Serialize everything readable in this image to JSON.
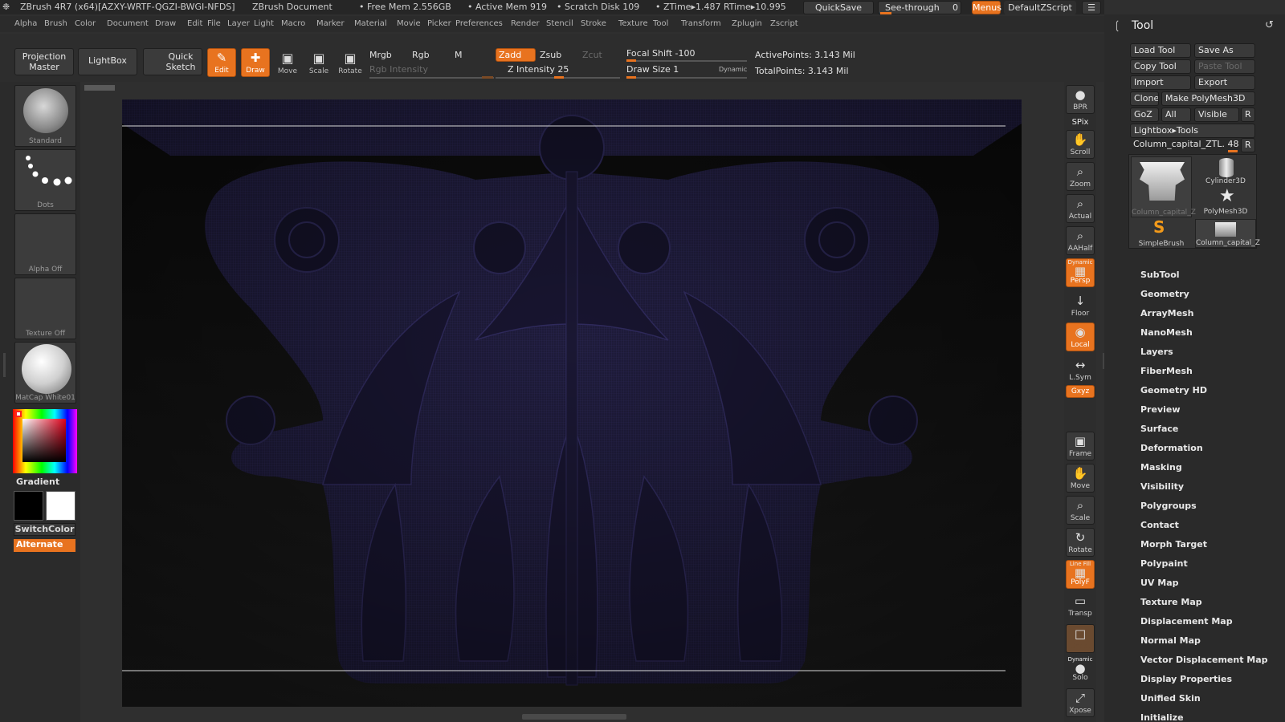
{
  "titlebar": {
    "app_title": "ZBrush 4R7 (x64)[AZXY-WRTF-QGZI-BWGI-NFDS]",
    "document": "ZBrush Document",
    "free_mem": "• Free Mem 2.556GB",
    "active_mem": "• Active Mem 919",
    "scratch_disk": "• Scratch Disk 109",
    "ztime": "• ZTime▸1.487 RTime▸10.995",
    "quicksave": "QuickSave",
    "seethrough_label": "See-through",
    "seethrough_value": "0",
    "menus": "Menus",
    "script": "DefaultZScript"
  },
  "menubar": [
    "Alpha",
    "Brush",
    "Color",
    "Document",
    "Draw",
    "Edit",
    "File",
    "Layer",
    "Light",
    "Macro",
    "Marker",
    "Material",
    "Movie",
    "Picker",
    "Preferences",
    "Render",
    "Stencil",
    "Stroke",
    "Texture",
    "Tool",
    "Transform",
    "Zplugin",
    "Zscript"
  ],
  "shelf": {
    "projection_master": "Projection Master",
    "lightbox": "LightBox",
    "quick_sketch": "Quick Sketch",
    "edit": "Edit",
    "draw": "Draw",
    "move": "Move",
    "scale": "Scale",
    "rotate": "Rotate",
    "mrgb": "Mrgb",
    "rgb": "Rgb",
    "m": "M",
    "rgb_intensity": "Rgb Intensity",
    "zadd": "Zadd",
    "zsub": "Zsub",
    "zcut": "Zcut",
    "z_intensity": "Z Intensity 25",
    "focal_shift": "Focal Shift -100",
    "draw_size": "Draw Size 1",
    "dynamic": "Dynamic",
    "active_points": "ActivePoints: 3.143 Mil",
    "total_points": "TotalPoints: 3.143 Mil"
  },
  "lefttray": {
    "brush": "Standard",
    "stroke": "Dots",
    "alpha": "Alpha Off",
    "texture": "Texture Off",
    "material": "MatCap White01",
    "gradient": "Gradient",
    "switchcolor": "SwitchColor",
    "alternate": "Alternate"
  },
  "rightdock": {
    "bpr": "BPR",
    "spix": "SPix",
    "scroll": "Scroll",
    "zoom": "Zoom",
    "actual": "Actual",
    "aahalf": "AAHalf",
    "persp_top": "Dynamic",
    "persp": "Persp",
    "floor": "Floor",
    "local": "Local",
    "lsym": "L.Sym",
    "xyz": "Gxyz",
    "frame": "Frame",
    "move": "Move",
    "scale": "Scale",
    "rotate": "Rotate",
    "polyf_top": "Line Fill",
    "polyf": "PolyF",
    "transp": "Transp",
    "ghost": "Ghost",
    "solo_top": "Dynamic",
    "solo": "Solo",
    "xpose": "Xpose"
  },
  "tool": {
    "title": "Tool",
    "load_tool": "Load Tool",
    "save_as": "Save As",
    "copy_tool": "Copy Tool",
    "paste_tool": "Paste Tool",
    "import": "Import",
    "export": "Export",
    "clone": "Clone",
    "make_polymesh": "Make PolyMesh3D",
    "goz": "GoZ",
    "all": "All",
    "visible": "Visible",
    "r": "R",
    "lightbox_tools": "Lightbox▸Tools",
    "current_tool": "Column_capital_ZTL. 48",
    "r2": "R",
    "thumbs": [
      {
        "label": "Column_capital_Z"
      },
      {
        "label": "Cylinder3D"
      },
      {
        "label": "PolyMesh3D"
      },
      {
        "label": "SimpleBrush"
      },
      {
        "label": "Column_capital_Z"
      }
    ],
    "sections": [
      "SubTool",
      "Geometry",
      "ArrayMesh",
      "NanoMesh",
      "Layers",
      "FiberMesh",
      "Geometry HD",
      "Preview",
      "Surface",
      "Deformation",
      "Masking",
      "Visibility",
      "Polygroups",
      "Contact",
      "Morph Target",
      "Polypaint",
      "UV Map",
      "Texture Map",
      "Displacement Map",
      "Normal Map",
      "Vector Displacement Map",
      "Display Properties",
      "Unified Skin",
      "Initialize"
    ]
  }
}
